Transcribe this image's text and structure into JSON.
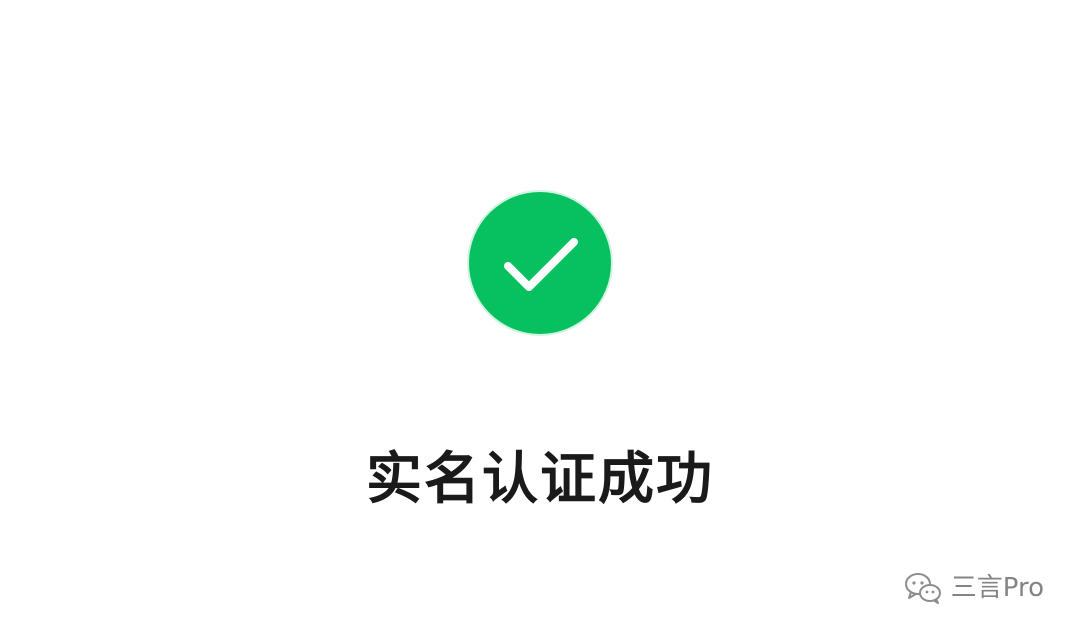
{
  "result": {
    "title": "实名认证成功",
    "icon": "check-circle-icon",
    "icon_color": "#07C160"
  },
  "watermark": {
    "icon": "wechat-channel-icon",
    "text": "三言Pro"
  }
}
